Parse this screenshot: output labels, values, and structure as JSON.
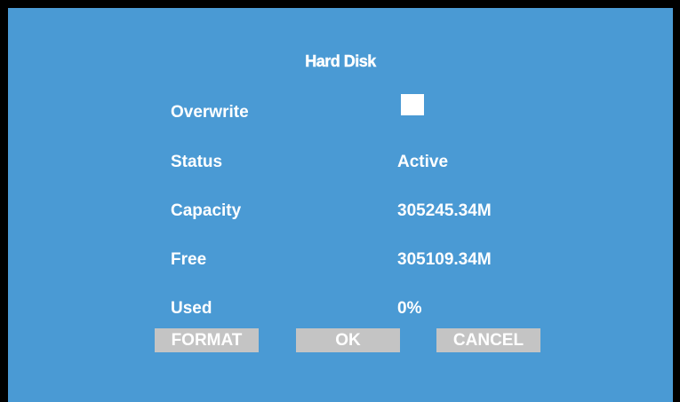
{
  "dialog": {
    "title": "Hard Disk"
  },
  "fields": {
    "overwrite": {
      "label": "Overwrite",
      "checked": false
    },
    "status": {
      "label": "Status",
      "value": "Active"
    },
    "capacity": {
      "label": "Capacity",
      "value": "305245.34M"
    },
    "free": {
      "label": "Free",
      "value": "305109.34M"
    },
    "used": {
      "label": "Used",
      "value": "0%"
    }
  },
  "buttons": {
    "format": "FORMAT",
    "ok": "OK",
    "cancel": "CANCEL"
  },
  "colors": {
    "panel_background": "#4a9ad4",
    "button_background": "#c4c4c4",
    "text": "#ffffff"
  }
}
